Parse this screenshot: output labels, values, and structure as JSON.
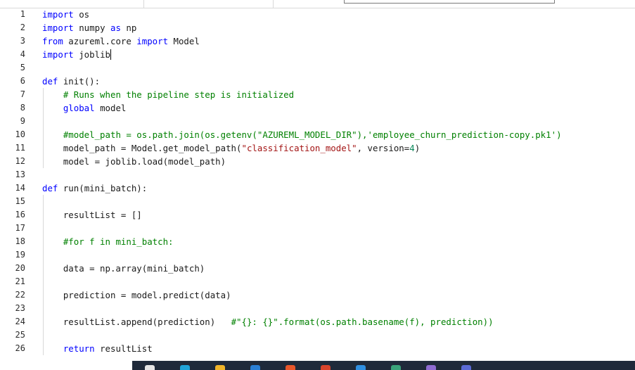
{
  "editor": {
    "lines": [
      {
        "n": "1",
        "segments": [
          {
            "t": "kw",
            "v": "import"
          },
          {
            "t": "txt",
            "v": " os"
          }
        ]
      },
      {
        "n": "2",
        "segments": [
          {
            "t": "kw",
            "v": "import"
          },
          {
            "t": "txt",
            "v": " numpy "
          },
          {
            "t": "kw",
            "v": "as"
          },
          {
            "t": "txt",
            "v": " np"
          }
        ]
      },
      {
        "n": "3",
        "segments": [
          {
            "t": "kw",
            "v": "from"
          },
          {
            "t": "txt",
            "v": " azureml.core "
          },
          {
            "t": "kw",
            "v": "import"
          },
          {
            "t": "txt",
            "v": " Model"
          }
        ]
      },
      {
        "n": "4",
        "segments": [
          {
            "t": "kw",
            "v": "import"
          },
          {
            "t": "txt",
            "v": " joblib"
          }
        ],
        "cursor": true
      },
      {
        "n": "5",
        "segments": []
      },
      {
        "n": "6",
        "segments": [
          {
            "t": "kw",
            "v": "def"
          },
          {
            "t": "txt",
            "v": " init():"
          }
        ]
      },
      {
        "n": "7",
        "segments": [
          {
            "t": "txt",
            "v": "    "
          },
          {
            "t": "cm",
            "v": "# Runs when the pipeline step is initialized"
          }
        ],
        "guide": true
      },
      {
        "n": "8",
        "segments": [
          {
            "t": "txt",
            "v": "    "
          },
          {
            "t": "kw",
            "v": "global"
          },
          {
            "t": "txt",
            "v": " model"
          }
        ],
        "guide": true
      },
      {
        "n": "9",
        "segments": [],
        "guide": true
      },
      {
        "n": "10",
        "segments": [
          {
            "t": "txt",
            "v": "    "
          },
          {
            "t": "cm",
            "v": "#model_path = os.path.join(os.getenv(\"AZUREML_MODEL_DIR\"),'employee_churn_prediction-copy.pk1')"
          }
        ],
        "guide": true
      },
      {
        "n": "11",
        "segments": [
          {
            "t": "txt",
            "v": "    model_path = Model.get_model_path("
          },
          {
            "t": "str",
            "v": "\"classification_model\""
          },
          {
            "t": "txt",
            "v": ", version="
          },
          {
            "t": "num",
            "v": "4"
          },
          {
            "t": "txt",
            "v": ")"
          }
        ],
        "guide": true
      },
      {
        "n": "12",
        "segments": [
          {
            "t": "txt",
            "v": "    model = joblib.load(model_path)"
          }
        ],
        "guide": true
      },
      {
        "n": "13",
        "segments": []
      },
      {
        "n": "14",
        "segments": [
          {
            "t": "kw",
            "v": "def"
          },
          {
            "t": "txt",
            "v": " run(mini_batch):"
          }
        ]
      },
      {
        "n": "15",
        "segments": [],
        "guide": true
      },
      {
        "n": "16",
        "segments": [
          {
            "t": "txt",
            "v": "    resultList = []"
          }
        ],
        "guide": true
      },
      {
        "n": "17",
        "segments": [],
        "guide": true
      },
      {
        "n": "18",
        "segments": [
          {
            "t": "txt",
            "v": "    "
          },
          {
            "t": "cm",
            "v": "#for f in mini_batch:"
          }
        ],
        "guide": true
      },
      {
        "n": "19",
        "segments": [],
        "guide": true
      },
      {
        "n": "20",
        "segments": [
          {
            "t": "txt",
            "v": "    data = np.array(mini_batch)"
          }
        ],
        "guide": true
      },
      {
        "n": "21",
        "segments": [],
        "guide": true
      },
      {
        "n": "22",
        "segments": [
          {
            "t": "txt",
            "v": "    prediction = model.predict(data)"
          }
        ],
        "guide": true
      },
      {
        "n": "23",
        "segments": [],
        "guide": true
      },
      {
        "n": "24",
        "segments": [
          {
            "t": "txt",
            "v": "    resultList.append(prediction)   "
          },
          {
            "t": "cm",
            "v": "#\"{}: {}\".format(os.path.basename(f), prediction))"
          }
        ],
        "guide": true
      },
      {
        "n": "25",
        "segments": [],
        "guide": true
      },
      {
        "n": "26",
        "segments": [
          {
            "t": "txt",
            "v": "    "
          },
          {
            "t": "kw",
            "v": "return"
          },
          {
            "t": "txt",
            "v": " resultList"
          }
        ],
        "guide": true
      }
    ]
  },
  "taskbar": {
    "icons": [
      {
        "name": "taskbar-app-icon-1",
        "color": "#e5e5e5"
      },
      {
        "name": "taskbar-app-icon-2",
        "color": "#1fa3d8"
      },
      {
        "name": "taskbar-app-icon-3",
        "color": "#f0b429"
      },
      {
        "name": "taskbar-app-icon-4",
        "color": "#2a7fd4"
      },
      {
        "name": "taskbar-app-icon-5",
        "color": "#e8562a"
      },
      {
        "name": "taskbar-app-icon-6",
        "color": "#d9442b"
      },
      {
        "name": "taskbar-app-icon-7",
        "color": "#2f8fe0"
      },
      {
        "name": "taskbar-app-icon-8",
        "color": "#3aa37a"
      },
      {
        "name": "taskbar-app-icon-9",
        "color": "#8e6bd1"
      },
      {
        "name": "taskbar-app-icon-10",
        "color": "#5b6bd6"
      }
    ]
  }
}
